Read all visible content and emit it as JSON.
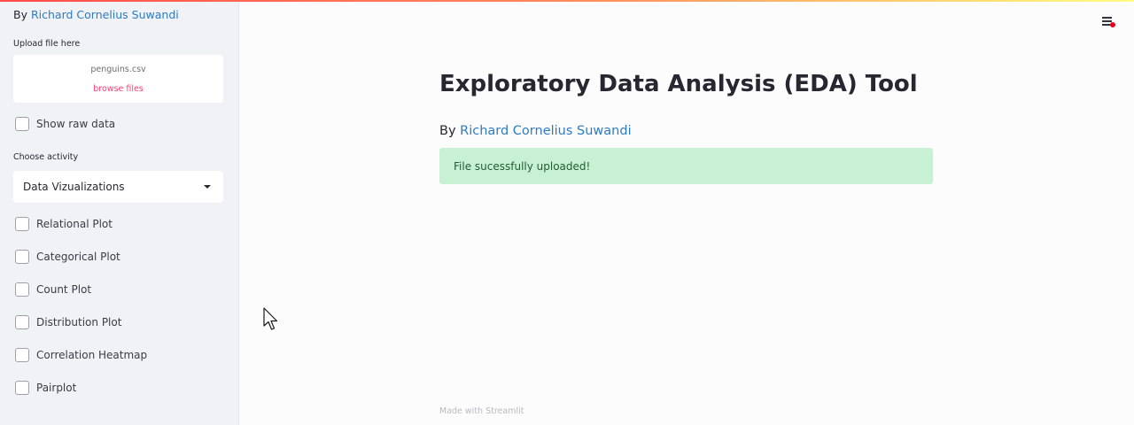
{
  "sidebar": {
    "byline_prefix": "By",
    "author": "Richard Cornelius Suwandi",
    "upload": {
      "label": "Upload file here",
      "filename": "penguins.csv",
      "browse_label": "browse files"
    },
    "show_raw_data": "Show raw data",
    "activity": {
      "label": "Choose activity",
      "selected": "Data Vizualizations"
    },
    "plots": [
      "Relational Plot",
      "Categorical Plot",
      "Count Plot",
      "Distribution Plot",
      "Correlation Heatmap",
      "Pairplot"
    ]
  },
  "main": {
    "title": "Exploratory Data Analysis (EDA) Tool",
    "byline_prefix": "By",
    "author": "Richard Cornelius Suwandi",
    "success_message": "File sucessfully uploaded!",
    "footer": "Made with Streamlit"
  },
  "icons": {
    "menu": "hamburger-menu-icon",
    "caret": "caret-down-icon",
    "cursor": "mouse-cursor"
  },
  "colors": {
    "accent": "#ff4b4b",
    "link": "#2f7bbf",
    "browse": "#ff3d74",
    "success_bg": "#c8f0d3",
    "notification_dot": "#e8001c"
  }
}
